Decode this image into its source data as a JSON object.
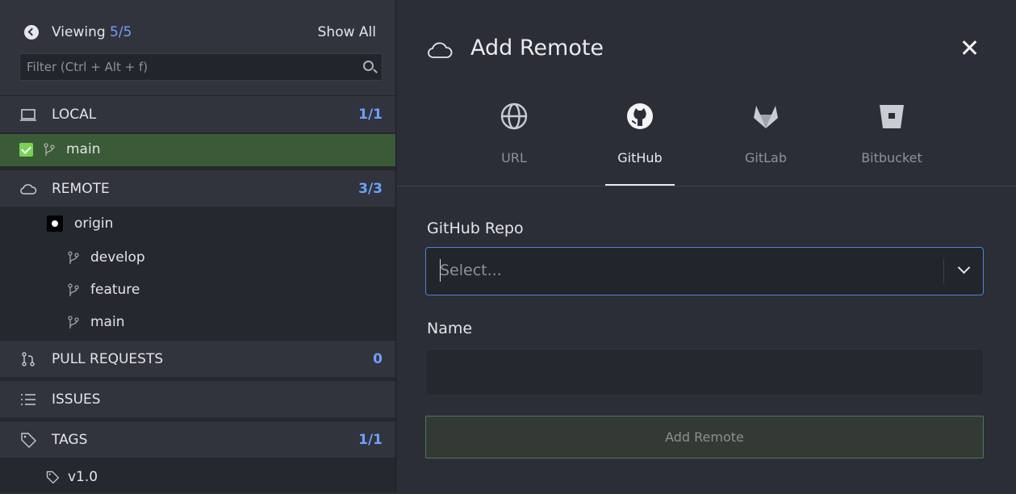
{
  "sidebar": {
    "viewing_label": "Viewing",
    "viewing_count": "5/5",
    "show_all_label": "Show All",
    "filter_placeholder": "Filter (Ctrl + Alt + f)",
    "sections": {
      "local": {
        "label": "LOCAL",
        "count": "1/1"
      },
      "remote": {
        "label": "REMOTE",
        "count": "3/3"
      },
      "pull_requests": {
        "label": "PULL REQUESTS",
        "count": "0"
      },
      "issues": {
        "label": "ISSUES"
      },
      "tags": {
        "label": "TAGS",
        "count": "1/1"
      }
    },
    "local_branches": [
      {
        "name": "main",
        "checked_out": true
      }
    ],
    "remotes": [
      {
        "name": "origin",
        "branches": [
          "develop",
          "feature",
          "main"
        ]
      }
    ],
    "tags": [
      "v1.0"
    ]
  },
  "dialog": {
    "title": "Add Remote",
    "tabs": [
      {
        "label": "URL",
        "icon": "globe-icon",
        "selected": false
      },
      {
        "label": "GitHub",
        "icon": "github-icon",
        "selected": true
      },
      {
        "label": "GitLab",
        "icon": "gitlab-icon",
        "selected": false
      },
      {
        "label": "Bitbucket",
        "icon": "bitbucket-icon",
        "selected": false
      }
    ],
    "repo_label": "GitHub Repo",
    "repo_placeholder": "Select...",
    "name_label": "Name",
    "name_value": "",
    "submit_label": "Add Remote"
  },
  "colors": {
    "accent_blue": "#6f9fff",
    "active_branch_bg": "#3b5a37",
    "checkbox_green": "#7ad255",
    "focus_border": "#4a86d8"
  }
}
